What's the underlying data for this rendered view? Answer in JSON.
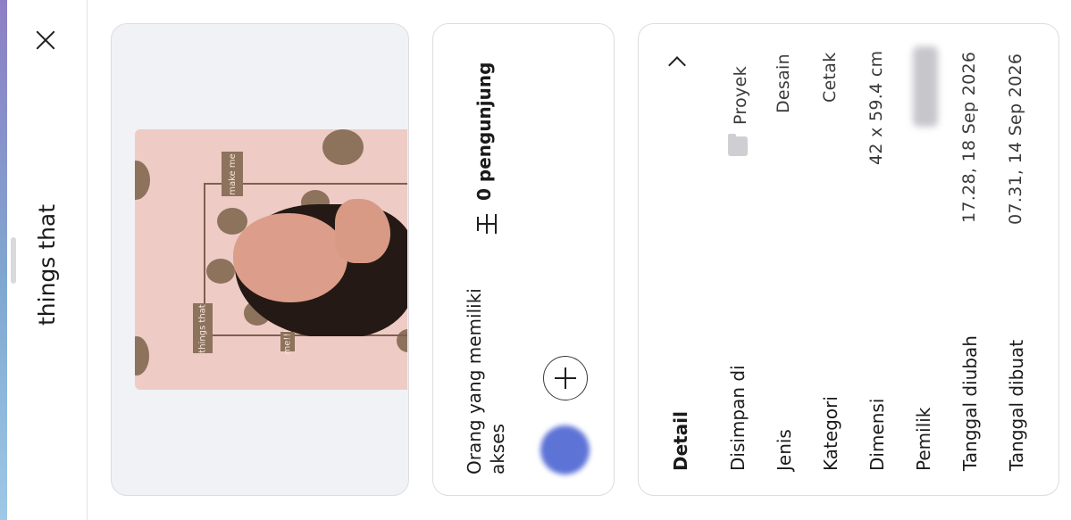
{
  "panel": {
    "title": "things that",
    "close_label": "close"
  },
  "preview": {
    "thumbnail_texts": {
      "tag_top": "make me",
      "tag_left": "things that",
      "tag_bottom": "me!!!"
    }
  },
  "access": {
    "title": "Orang yang memiliki akses",
    "visitors": "0 pengunjung"
  },
  "details": {
    "heading": "Detail",
    "rows": [
      {
        "label": "Disimpan di",
        "value": "Proyek"
      },
      {
        "label": "Jenis",
        "value": "Desain"
      },
      {
        "label": "Kategori",
        "value": "Cetak"
      },
      {
        "label": "Dimensi",
        "value": "42 x 59.4 cm"
      },
      {
        "label": "Pemilik",
        "value": ""
      },
      {
        "label": "Tanggal diubah",
        "value": "17.28, 18 Sep 2026"
      },
      {
        "label": "Tanggal dibuat",
        "value": "07.31, 14 Sep 2026"
      }
    ]
  },
  "colors": {
    "accent_avatar": "#5d73d6",
    "thumb_bg": "#efcbc6",
    "thumb_dots": "#8d725c"
  }
}
